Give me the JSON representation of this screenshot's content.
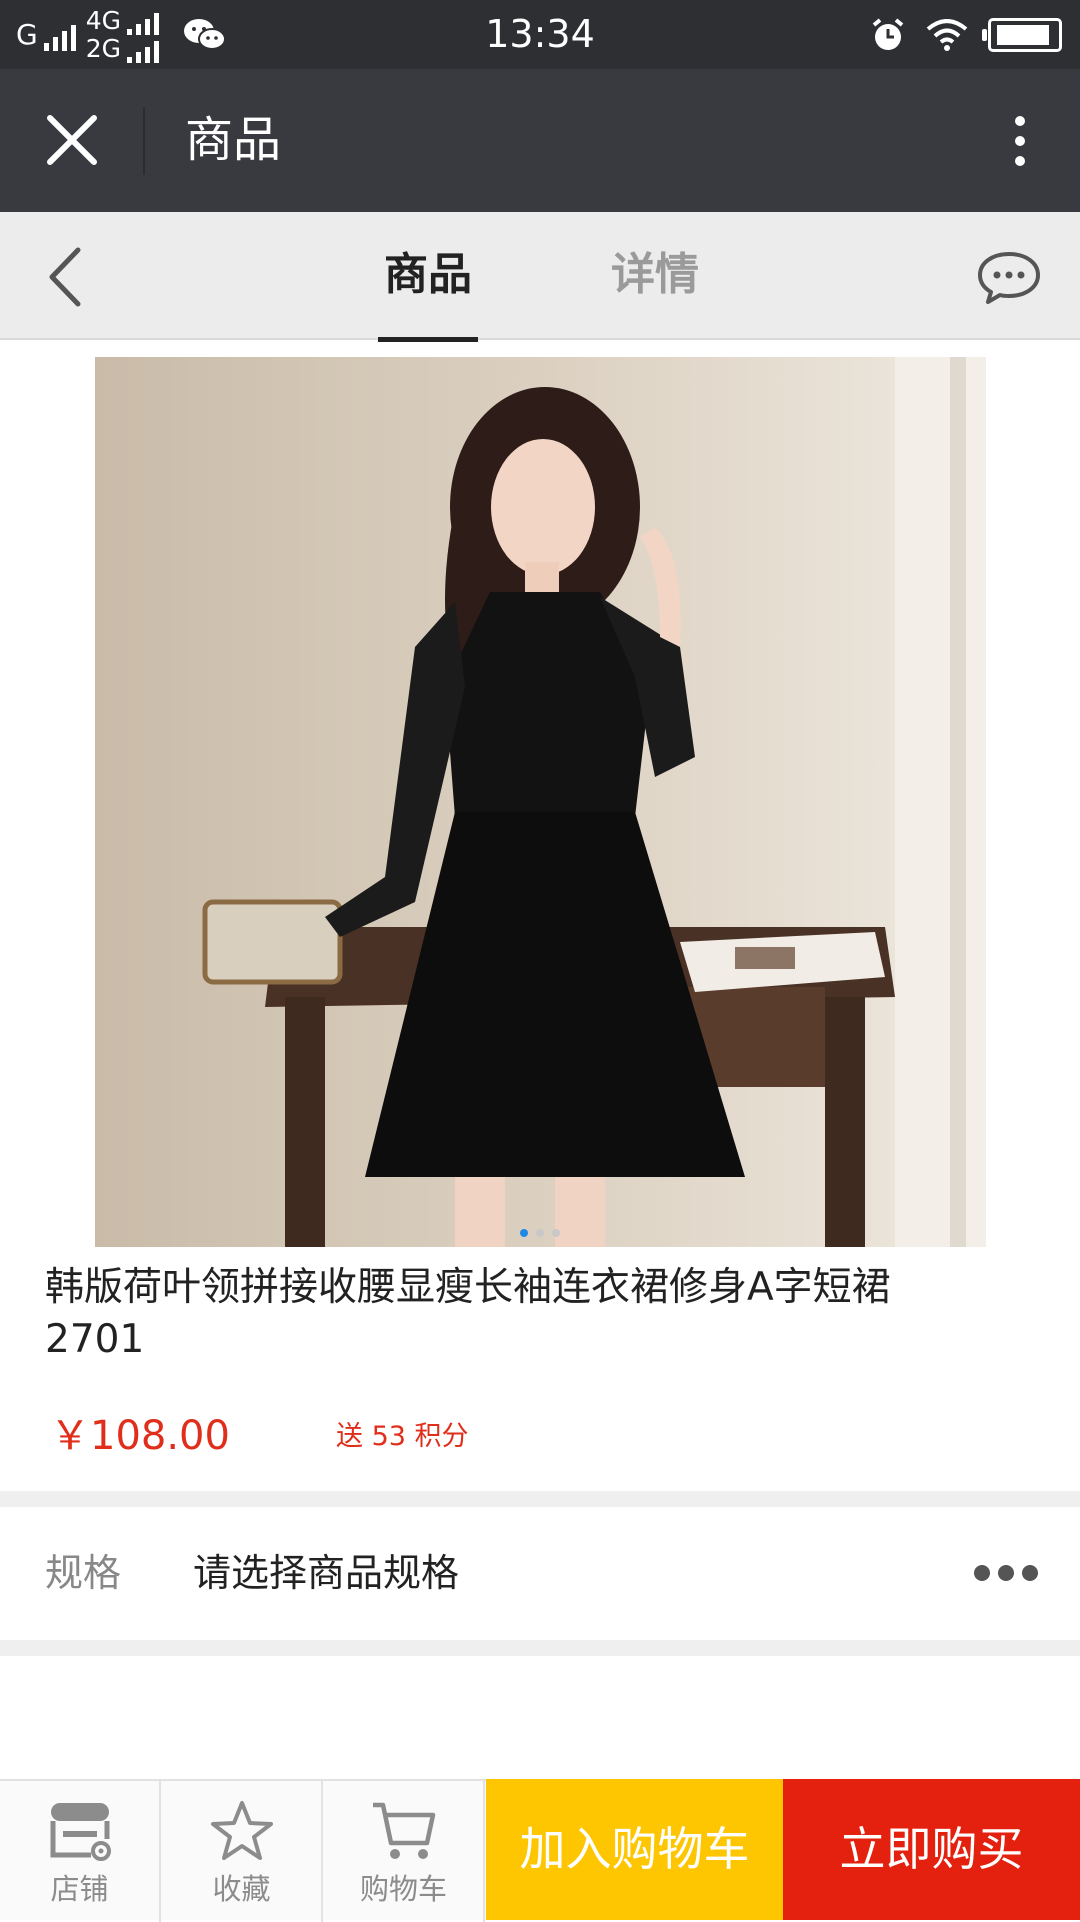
{
  "status_bar": {
    "carrier_1": "G",
    "network_4g": "4G",
    "network_2g": "2G",
    "time": "13:34",
    "icons": [
      "wechat-icon",
      "alarm-icon",
      "wifi-icon",
      "battery-icon"
    ],
    "battery_level": 0.85
  },
  "header": {
    "title": "商品",
    "close_icon": "close-icon",
    "more_icon": "more-vertical-icon"
  },
  "tabs": {
    "items": [
      "商品",
      "详情"
    ],
    "active_index": 0
  },
  "product": {
    "image_count": 3,
    "image_active": 0,
    "title": "韩版荷叶领拼接收腰显瘦长袖连衣裙修身A字短裙2701",
    "price": "￥108.00",
    "points": "送 53 积分"
  },
  "spec": {
    "label": "规格",
    "value": "请选择商品规格"
  },
  "bottom_bar": {
    "shop_label": "店铺",
    "favorite_label": "收藏",
    "cart_label": "购物车",
    "add_to_cart": "加入购物车",
    "buy_now": "立即购买"
  },
  "colors": {
    "accent_red": "#e4200f",
    "accent_yellow": "#fec601",
    "price_red": "#e02e1b",
    "header_dark": "#393a3f"
  }
}
